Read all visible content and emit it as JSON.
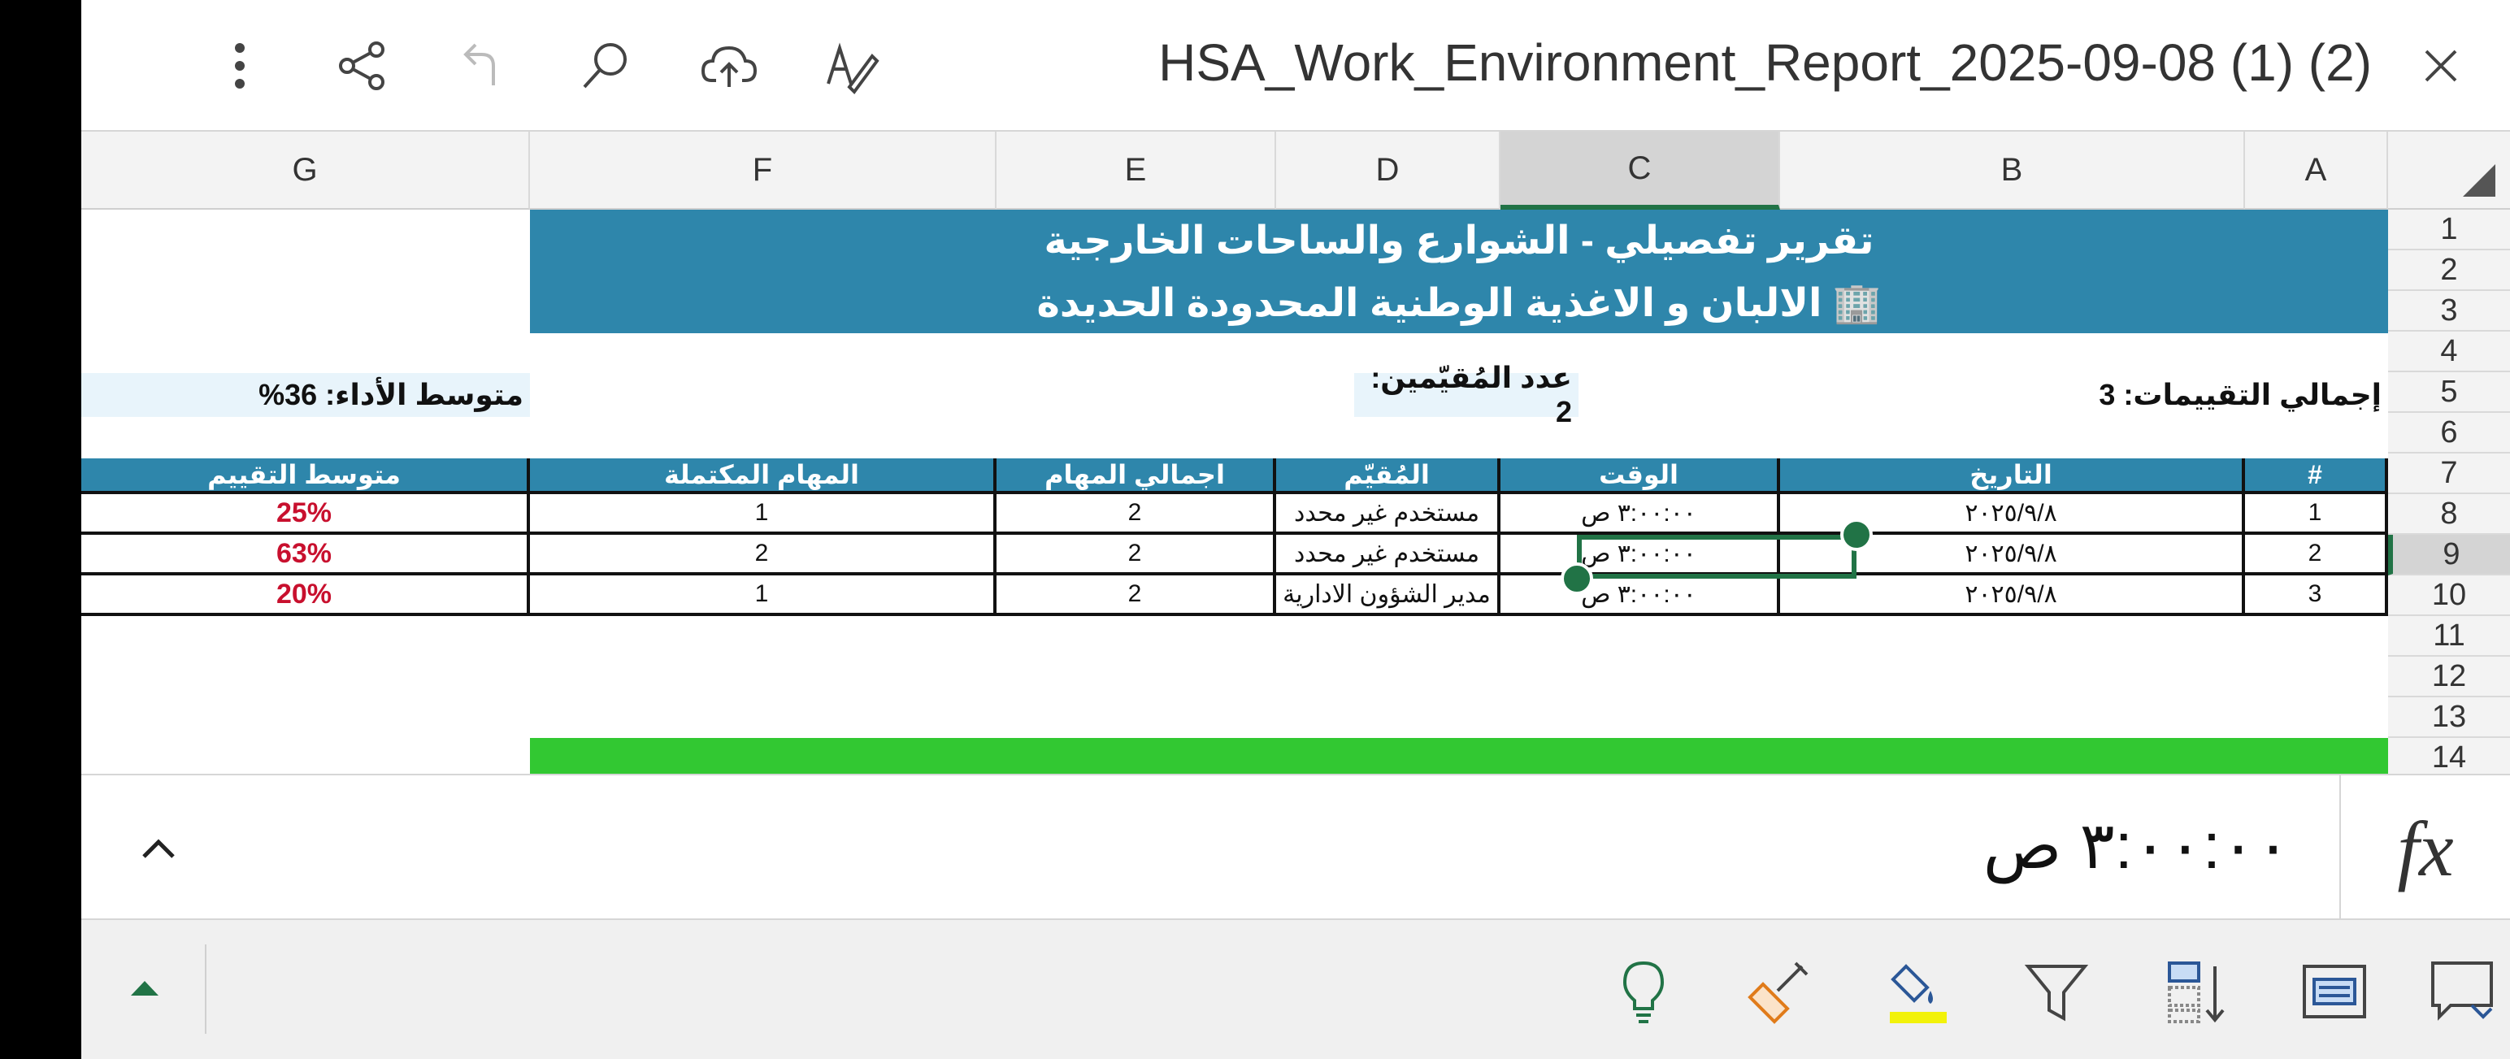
{
  "topbar": {
    "title": "HSA_Work_Environment_Report_2025-09-08 (1) (2)",
    "icons": [
      "more-icon",
      "share-icon",
      "redo-icon",
      "search-icon",
      "cloud-upload-icon",
      "draw-icon",
      "close-icon"
    ]
  },
  "columns": [
    "G",
    "F",
    "E",
    "D",
    "C",
    "B",
    "A"
  ],
  "rows": [
    "1",
    "2",
    "3",
    "4",
    "5",
    "6",
    "7",
    "8",
    "9",
    "10",
    "11",
    "12",
    "13",
    "14"
  ],
  "sheet": {
    "banner_title": "تقرير تفصيلي - الشوارع والساحات الخارجية",
    "banner_company": "🏢 الالبان و الاغذية الوطنية المحدودة الحديدة",
    "total_evaluations": "إجمالي التقييمات: 3",
    "evaluators_count": "عدد المُقيّمين: 2",
    "avg_performance": "متوسط الأداء: 36%",
    "table": {
      "headers": [
        "#",
        "التاريخ",
        "الوقت",
        "المُقيّم",
        "اجمالي المهام",
        "المهام المكتملة",
        "متوسط التقييم"
      ],
      "rows": [
        [
          "1",
          "٢٠٢٥/٩/٨",
          "٣:٠٠:٠٠ ص",
          "مستخدم غير محدد",
          "2",
          "1",
          "25%"
        ],
        [
          "2",
          "٢٠٢٥/٩/٨",
          "٣:٠٠:٠٠ ص",
          "مستخدم غير محدد",
          "2",
          "2",
          "63%"
        ],
        [
          "3",
          "٢٠٢٥/٩/٨",
          "٣:٠٠:٠٠ ص",
          "مدير الشؤون الادارية",
          "2",
          "1",
          "20%"
        ]
      ]
    }
  },
  "formula_bar": {
    "value": "٣:٠٠:٠٠ ص",
    "fx_label": "fx"
  },
  "bottom_toolbar": {
    "icons": [
      "ideas-icon",
      "clear-format-icon",
      "fill-color-icon",
      "filter-icon",
      "sort-icon",
      "wrap-text-icon",
      "comment-icon"
    ]
  },
  "colors": {
    "banner": "#2e86ab",
    "selection": "#217346",
    "percent": "#c8102e",
    "green_bar": "#32c832"
  }
}
